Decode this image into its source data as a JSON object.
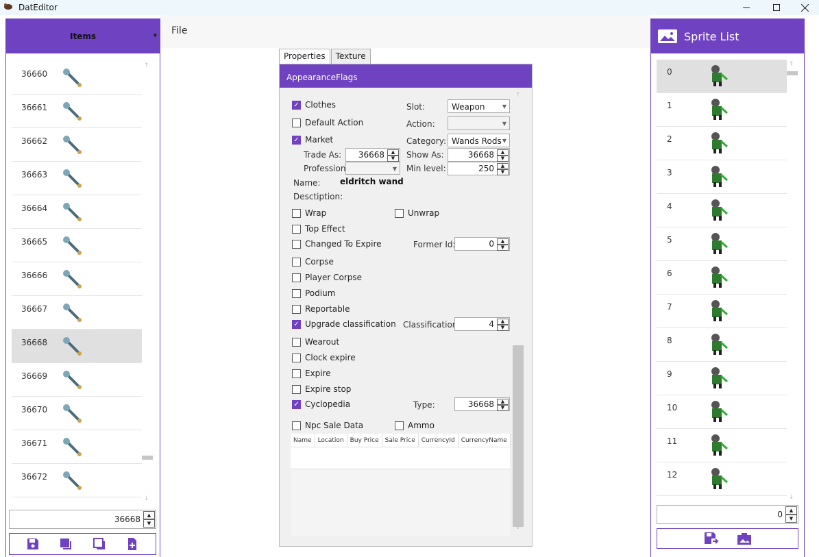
{
  "window": {
    "title": "DatEditor"
  },
  "left_panel": {
    "header": "Items",
    "items": [
      {
        "id": "36660",
        "icon": "staff-sprite"
      },
      {
        "id": "36661",
        "icon": "rod-sprite"
      },
      {
        "id": "36662",
        "icon": "staff-sprite"
      },
      {
        "id": "36663",
        "icon": "armor-sprite"
      },
      {
        "id": "36664",
        "icon": "bow-sprite"
      },
      {
        "id": "36665",
        "icon": "bow-sprite"
      },
      {
        "id": "36666",
        "icon": "quiver-sprite"
      },
      {
        "id": "36667",
        "icon": "legs-sprite"
      },
      {
        "id": "36668",
        "icon": "wand-sprite",
        "selected": true
      },
      {
        "id": "36669",
        "icon": "rod-sprite"
      },
      {
        "id": "36670",
        "icon": "helmet-sprite"
      },
      {
        "id": "36671",
        "icon": "helmet-sprite"
      },
      {
        "id": "36672",
        "icon": "armor-sprite"
      }
    ],
    "spin_value": "36668"
  },
  "menu": {
    "file": "File"
  },
  "tabs": {
    "properties": "Properties",
    "texture": "Texture"
  },
  "props": {
    "header": "AppearanceFlags",
    "clothes": "Clothes",
    "slot_label": "Slot:",
    "slot_value": "Weapon",
    "default_action": "Default Action",
    "action_label": "Action:",
    "action_value": "",
    "market": "Market",
    "category_label": "Category:",
    "category_value": "Wands Rods",
    "trade_as_label": "Trade As:",
    "trade_as_value": "36668",
    "show_as_label": "Show As:",
    "show_as_value": "36668",
    "profession_label": "Profession:",
    "profession_value": "",
    "min_level_label": "Min level:",
    "min_level_value": "250",
    "name_label": "Name:",
    "name_value": "eldritch wand",
    "description_label": "Desctiption:",
    "wrap": "Wrap",
    "unwrap": "Unwrap",
    "top_effect": "Top Effect",
    "changed_to_expire": "Changed To Expire",
    "former_id_label": "Former Id:",
    "former_id_value": "0",
    "corpse": "Corpse",
    "player_corpse": "Player Corpse",
    "podium": "Podium",
    "reportable": "Reportable",
    "upgrade_classification": "Upgrade classification",
    "classification_label": "Classification:",
    "classification_value": "4",
    "wearout": "Wearout",
    "clock_expire": "Clock expire",
    "expire": "Expire",
    "expire_stop": "Expire stop",
    "cyclopedia": "Cyclopedia",
    "type_label": "Type:",
    "type_value": "36668",
    "npc_sale_data": "Npc Sale Data",
    "ammo": "Ammo",
    "grid_columns": [
      "Name",
      "Location",
      "Buy Price",
      "Sale Price",
      "CurrencyId",
      "CurrencyName"
    ]
  },
  "right_panel": {
    "header": "Sprite List",
    "sprites": [
      "0",
      "1",
      "2",
      "3",
      "4",
      "5",
      "6",
      "7",
      "8",
      "9",
      "10",
      "11",
      "12"
    ],
    "spin_value": "0"
  },
  "colors": {
    "accent": "#6f42c1"
  }
}
